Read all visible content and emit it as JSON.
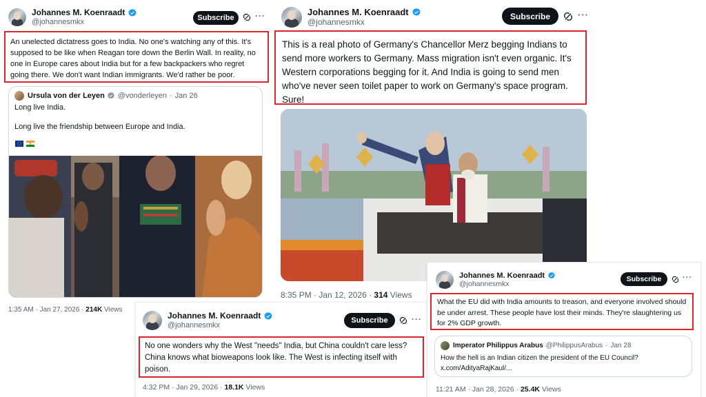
{
  "verified_color": "#1d9bf0",
  "highlight_color": "#d9252b",
  "tweets": [
    {
      "author": "Johannes M. Koenraadt",
      "handle": "@johannesmkx",
      "subscribe": "Subscribe",
      "text": "An unelected dictatress goes to India. No one's watching any of this. It's supposed to be like when Reagan tore down the Berlin Wall. In reality, no one in Europe cares about India but for a few backpackers who regret going there. We don't want Indian immigrants. We'd rather be poor.",
      "quote": {
        "author": "Ursula von der Leyen",
        "handle": "@vonderleyen",
        "date": "Jan 26",
        "line1": "Long live India.",
        "line2": "Long live the friendship between Europe and India.",
        "flags": [
          "EU flag",
          "India flag"
        ]
      },
      "time": "1:35 AM · Jan 27, 2026 · ",
      "views": "214K",
      "views_label": " Views"
    },
    {
      "author": "Johannes M. Koenraadt",
      "handle": "@johannesmkx",
      "subscribe": "Subscribe",
      "text": "This is a real photo of Germany's Chancellor Merz begging Indians to send more workers to Germany. Mass migration isn't even organic. It's Western corporations begging for it. And India is going to send men who've never seen toilet paper to work on Germany's space program. Sure!",
      "time": "8:35 PM · Jan 12, 2026 · ",
      "views": "314",
      "views_label": " Views"
    },
    {
      "author": "Johannes M. Koenraadt",
      "handle": "@johannesmkx",
      "subscribe": "Subscribe",
      "text": "No one wonders why the West \"needs\" India, but China couldn't care less? China knows what bioweapons look like. The West is infecting itself with poison.",
      "time": "4:32 PM · Jan 29, 2026 · ",
      "views": "18.1K",
      "views_label": " Views"
    },
    {
      "author": "Johannes M. Koenraadt",
      "handle": "@johannesmkx",
      "subscribe": "Subscribe",
      "text": "What the EU did with India amounts to treason, and everyone involved should be under arrest. These people have lost their minds. They're slaughtering us for 2% GDP growth.",
      "quote": {
        "author": "Imperator Philippus Arabus",
        "handle": "@PhilippusArabus",
        "date": "Jan 28",
        "line1": "How the hell is an Indian citizen the president of the EU Council?",
        "line2": "x.com/AdityaRajKaul/..."
      },
      "time": "11:21 AM · Jan 28, 2026 · ",
      "views": "25.4K",
      "views_label": " Views"
    }
  ],
  "icons": [
    "verified-badge-icon",
    "grok-icon",
    "more-icon",
    "eu-flag-icon",
    "india-flag-icon"
  ]
}
